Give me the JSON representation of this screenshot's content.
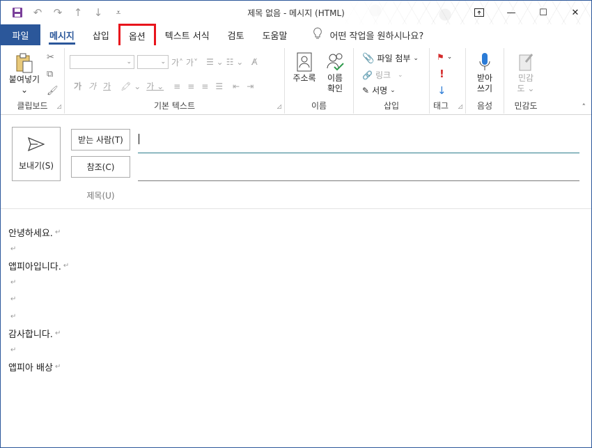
{
  "window": {
    "title": "제목 없음 - 메시지 (HTML)",
    "controls": {
      "ribbon_display": "⊡",
      "minimize": "—",
      "maximize": "☐",
      "close": "✕"
    }
  },
  "qat": {
    "save": "💾",
    "undo": "↶",
    "redo": "↷",
    "up": "↑",
    "down": "↓",
    "customize": "⩡"
  },
  "tabs": [
    {
      "label": "파일"
    },
    {
      "label": "메시지"
    },
    {
      "label": "삽입"
    },
    {
      "label": "옵션"
    },
    {
      "label": "텍스트 서식"
    },
    {
      "label": "검토"
    },
    {
      "label": "도움말"
    }
  ],
  "tell_me": {
    "icon": "lightbulb-icon",
    "placeholder": "어떤 작업을 원하시나요?"
  },
  "ribbon": {
    "clipboard": {
      "label": "클립보드",
      "paste_line1": "붙여넣기",
      "paste_line2": "⌄"
    },
    "basic_text": {
      "label": "기본 텍스트",
      "bold": "가",
      "italic": "가",
      "underline": "가",
      "grow": "가˄",
      "shrink": "가˅"
    },
    "names": {
      "label": "이름",
      "address_book": "주소록",
      "check_names_1": "이름",
      "check_names_2": "확인"
    },
    "include": {
      "label": "삽입",
      "attach_file": "파일 첨부",
      "link": "링크",
      "signature": "서명"
    },
    "tags": {
      "label": "태그"
    },
    "voice": {
      "label": "음성",
      "dictate_1": "받아",
      "dictate_2": "쓰기"
    },
    "sensitivity": {
      "label": "민감도",
      "btn_1": "민감",
      "btn_2": "도"
    }
  },
  "header": {
    "send": "보내기(S)",
    "to_button": "받는 사람(T)",
    "cc_button": "참조(C)",
    "subject_label": "제목(U)",
    "to_value": "",
    "cc_value": "",
    "subject_value": ""
  },
  "body": {
    "lines": [
      "안녕하세요.",
      "",
      "앱피아입니다. ",
      "",
      "",
      "",
      "감사합니다. ",
      "",
      "앱피아  배상 "
    ],
    "paragraph_mark": "↵"
  },
  "colors": {
    "accent": "#2b579a",
    "highlight": "#e8141c"
  }
}
